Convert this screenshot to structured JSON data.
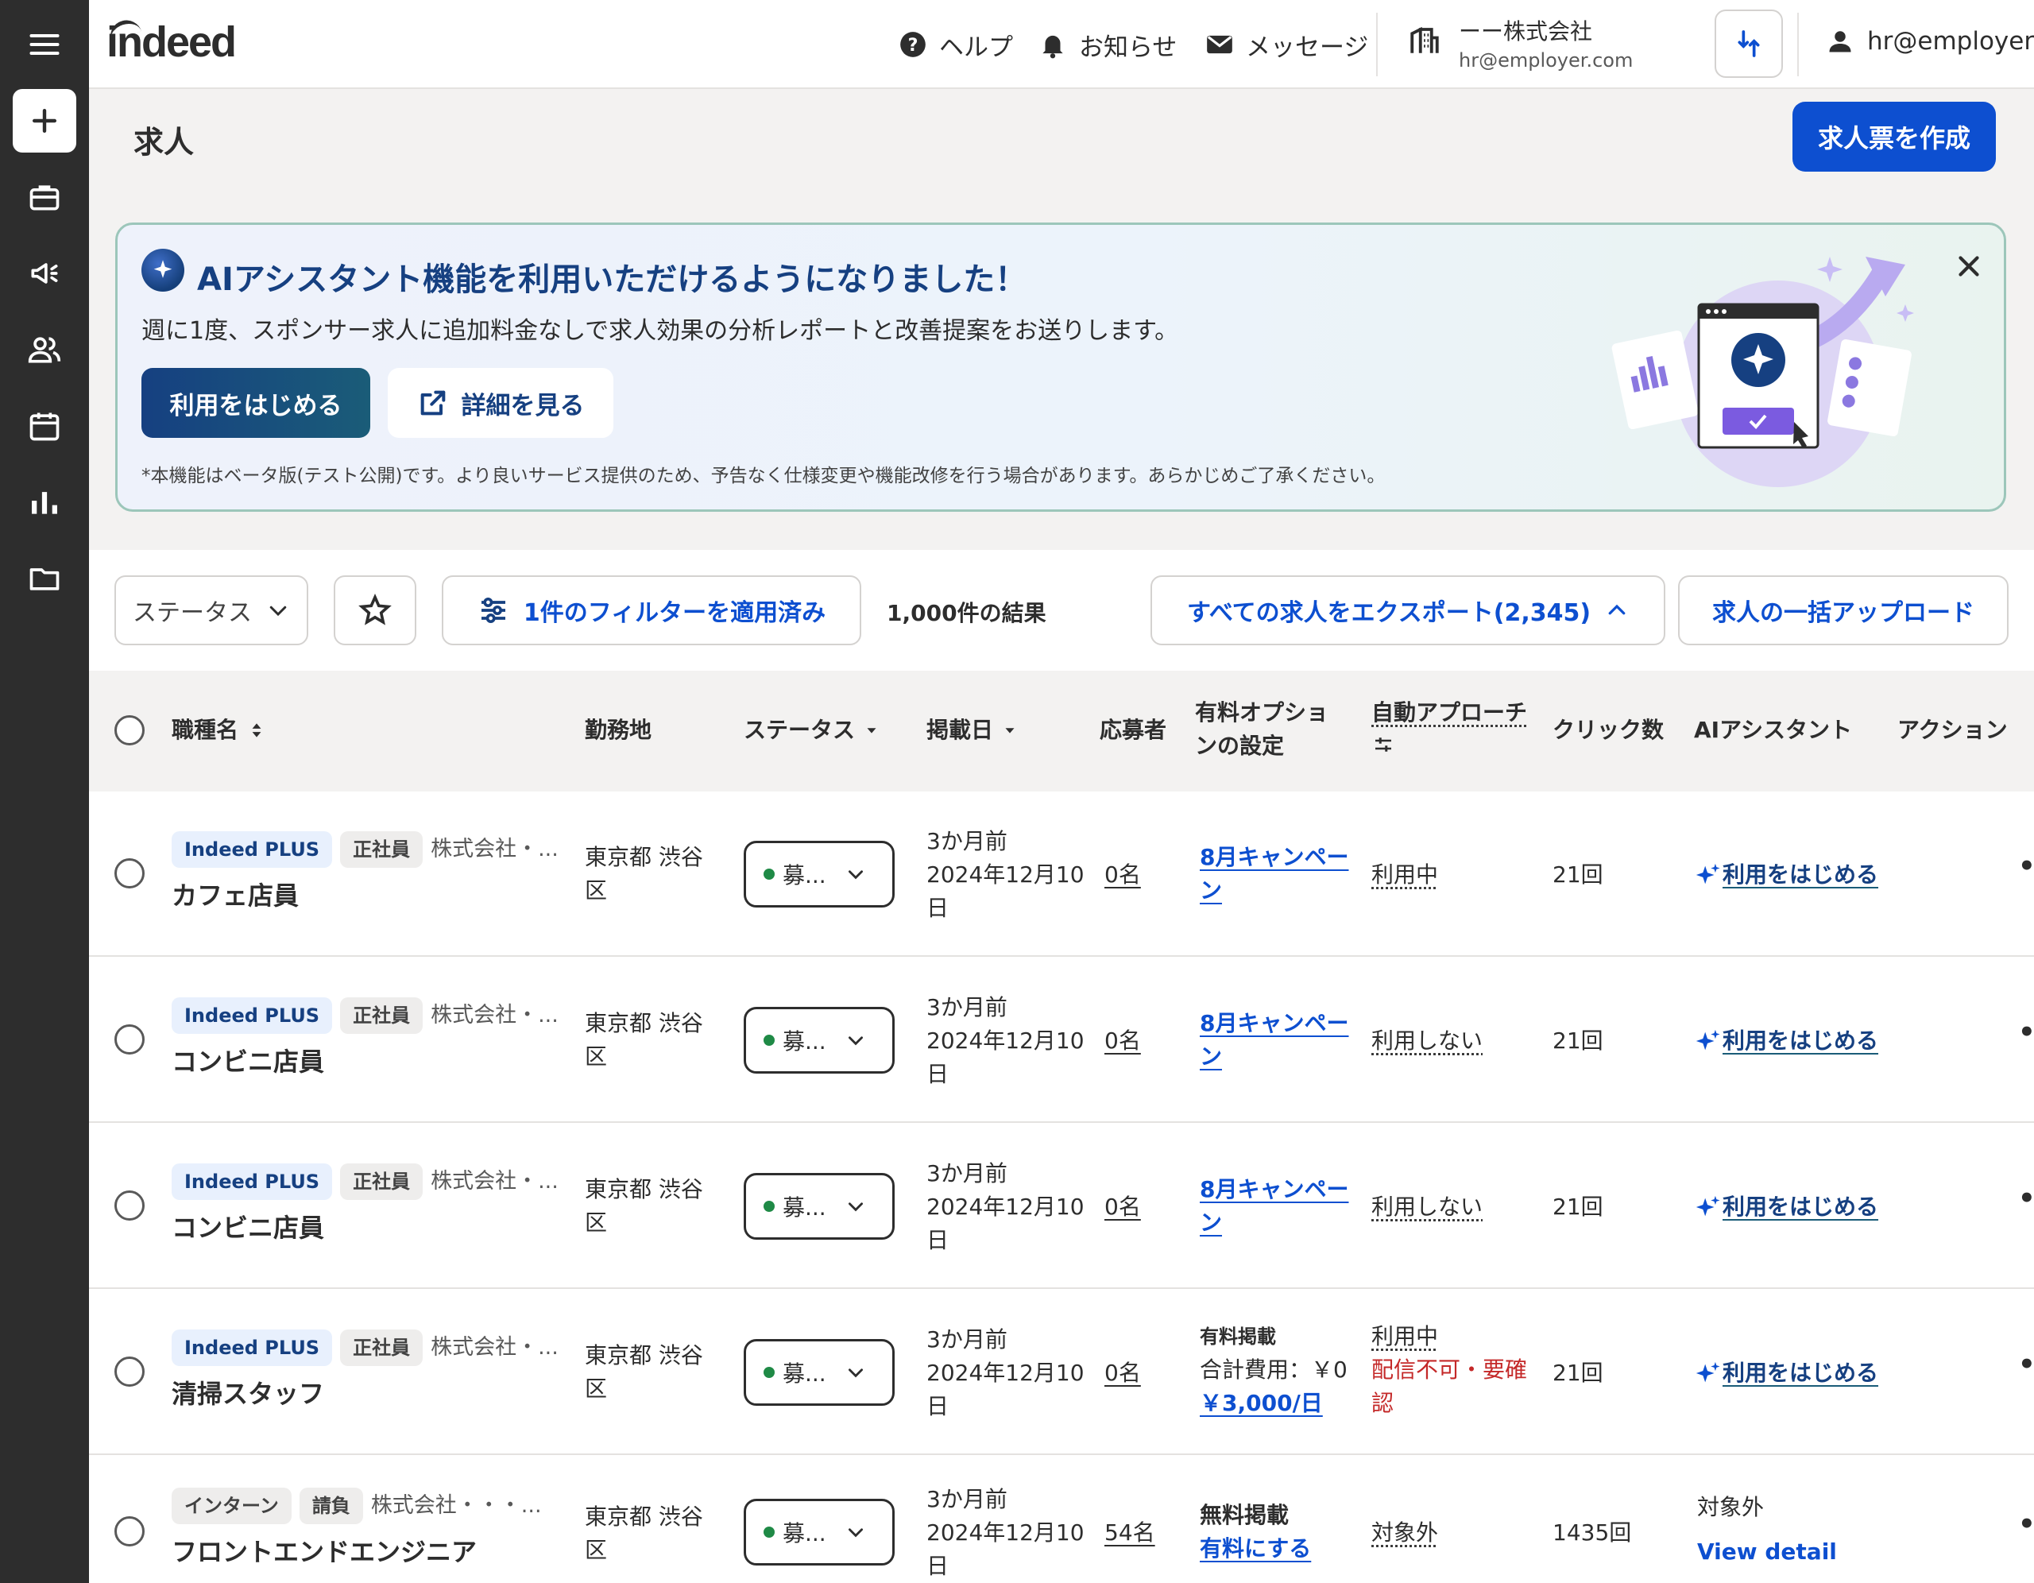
{
  "sidebar": {
    "items": [
      "menu-icon",
      "create-icon",
      "jobs-icon",
      "campaign-icon",
      "candidates-icon",
      "calendar-icon",
      "analytics-icon",
      "folder-icon"
    ]
  },
  "header": {
    "logo": "indeed",
    "help": "ヘルプ",
    "notifications": "お知らせ",
    "messages": "メッセージ",
    "company_name": "ーー株式会社",
    "company_email": "hr@employer.com",
    "user_email": "hr@employer.co..."
  },
  "page": {
    "title": "求人",
    "create_button": "求人票を作成"
  },
  "banner": {
    "title": "AIアシスタント機能を利用いただけるようになりました！",
    "description": "週に1度、スポンサー求人に追加料金なしで求人効果の分析レポートと改善提案をお送りします。",
    "start_button": "利用をはじめる",
    "detail_button": "詳細を見る",
    "note": "*本機能はベータ版(テスト公開)です。より良いサービス提供のため、予告なく仕様変更や機能改修を行う場合があります。あらかじめご了承ください。",
    "colors": {
      "title": "#164081",
      "border": "#9cc6ba"
    }
  },
  "toolbar": {
    "status_filter": "ステータス",
    "filter_applied": "1件のフィルターを適用済み",
    "results": "1,000件の結果",
    "export": "すべての求人をエクスポート(2,345)",
    "bulk_upload": "求人の一括アップロード"
  },
  "table": {
    "headers": {
      "job_title": "職種名",
      "location": "勤務地",
      "status": "ステータス",
      "posted": "掲載日",
      "applicants": "応募者",
      "paid_option_1": "有料オプショ",
      "paid_option_2": "ンの設定",
      "auto_approach": "自動アプローチ",
      "clicks": "クリック数",
      "ai_assistant": "AIアシスタント",
      "actions": "アクション"
    },
    "rows": [
      {
        "tag1": "Indeed PLUS",
        "tag2": "正社員",
        "company": "株式会社・...",
        "title": "カフェ店員",
        "location1": "東京都 渋谷",
        "location2": "区",
        "status": "募...",
        "posted1": "3か月前",
        "posted2": "2024年12月10",
        "posted3": "日",
        "applicants": "0名",
        "option1": "8月キャンペー",
        "option2": "ン",
        "auto": "利用中",
        "clicks": "21回",
        "ai": "利用をはじめる"
      },
      {
        "tag1": "Indeed PLUS",
        "tag2": "正社員",
        "company": "株式会社・...",
        "title": "コンビニ店員",
        "location1": "東京都 渋谷",
        "location2": "区",
        "status": "募...",
        "posted1": "3か月前",
        "posted2": "2024年12月10",
        "posted3": "日",
        "applicants": "0名",
        "option1": "8月キャンペー",
        "option2": "ン",
        "auto": "利用しない",
        "clicks": "21回",
        "ai": "利用をはじめる"
      },
      {
        "tag1": "Indeed PLUS",
        "tag2": "正社員",
        "company": "株式会社・...",
        "title": "コンビニ店員",
        "location1": "東京都 渋谷",
        "location2": "区",
        "status": "募...",
        "posted1": "3か月前",
        "posted2": "2024年12月10",
        "posted3": "日",
        "applicants": "0名",
        "option1": "8月キャンペー",
        "option2": "ン",
        "auto": "利用しない",
        "clicks": "21回",
        "ai": "利用をはじめる"
      },
      {
        "tag1": "Indeed PLUS",
        "tag2": "正社員",
        "company": "株式会社・...",
        "title": "清掃スタッフ",
        "location1": "東京都 渋谷",
        "location2": "区",
        "status": "募...",
        "posted1": "3か月前",
        "posted2": "2024年12月10",
        "posted3": "日",
        "applicants": "0名",
        "option_label": "有料掲載",
        "option_cost": "合計費用：￥0",
        "option_budget": "￥3,000/日",
        "auto": "利用中",
        "auto_warn1": "配信不可・要確",
        "auto_warn2": "認",
        "clicks": "21回",
        "ai": "利用をはじめる"
      },
      {
        "tag1": "インターン",
        "tag2": "請負",
        "company": "株式会社・・・...",
        "title": "フロントエンドエンジニア",
        "location1": "東京都 渋谷",
        "location2": "区",
        "status": "募...",
        "posted1": "3か月前",
        "posted2": "2024年12月10",
        "posted3": "日",
        "applicants": "54名",
        "option_label": "無料掲載",
        "option_link": "有料にする",
        "auto": "対象外",
        "clicks": "1435回",
        "ai_status": "対象外",
        "ai_link": "View detail"
      }
    ]
  }
}
